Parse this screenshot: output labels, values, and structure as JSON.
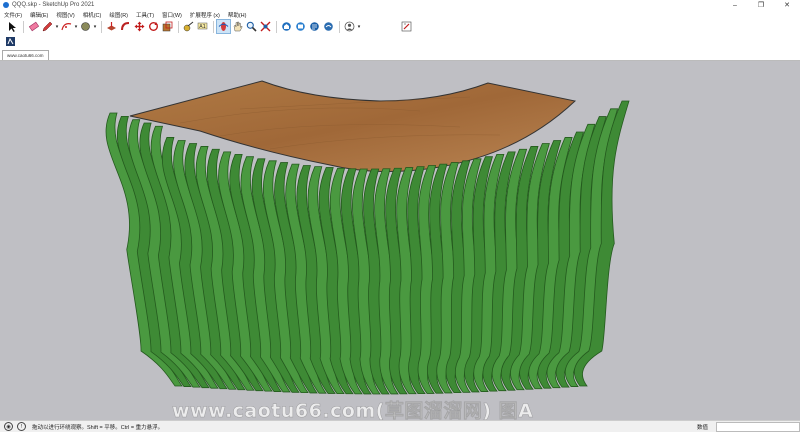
{
  "window": {
    "title": "QQQ.skp - SketchUp Pro 2021",
    "controls": [
      "–",
      "❐",
      "✕"
    ]
  },
  "menu": [
    "文件(F)",
    "编辑(E)",
    "视图(V)",
    "相机(C)",
    "绘图(R)",
    "工具(T)",
    "窗口(W)",
    "扩展程序 (x)",
    "帮助(H)"
  ],
  "scene_tab": {
    "label": "www.caotu66.com"
  },
  "watermark": "www.caotu66.com(草图溜溜网) 图A",
  "status": {
    "hint": "拖动以进行环绕观察。Shift = 平移。Ctrl = 重力悬浮。",
    "measure_label": "数值",
    "measure_value": ""
  },
  "colors": {
    "viewport_bg": "#bfbfc4",
    "slat_green": "#3e8a35",
    "slat_dark": "#245a1e",
    "wood_top": "#a96e38"
  },
  "toolbar_icons": [
    "select-icon",
    "eraser-icon",
    "pencil-icon",
    "arc-icon",
    "shape-icon",
    "pushpull-icon",
    "followme-icon",
    "move-icon",
    "rotate-icon",
    "scale-icon",
    "tape-icon",
    "text-icon",
    "orbit-icon",
    "pan-icon",
    "zoom-icon",
    "zoom-extents-icon",
    "warehouse-icon",
    "extension-warehouse-icon",
    "layout-icon",
    "extension-manager-icon",
    "account-icon",
    "ruby-icon"
  ]
}
